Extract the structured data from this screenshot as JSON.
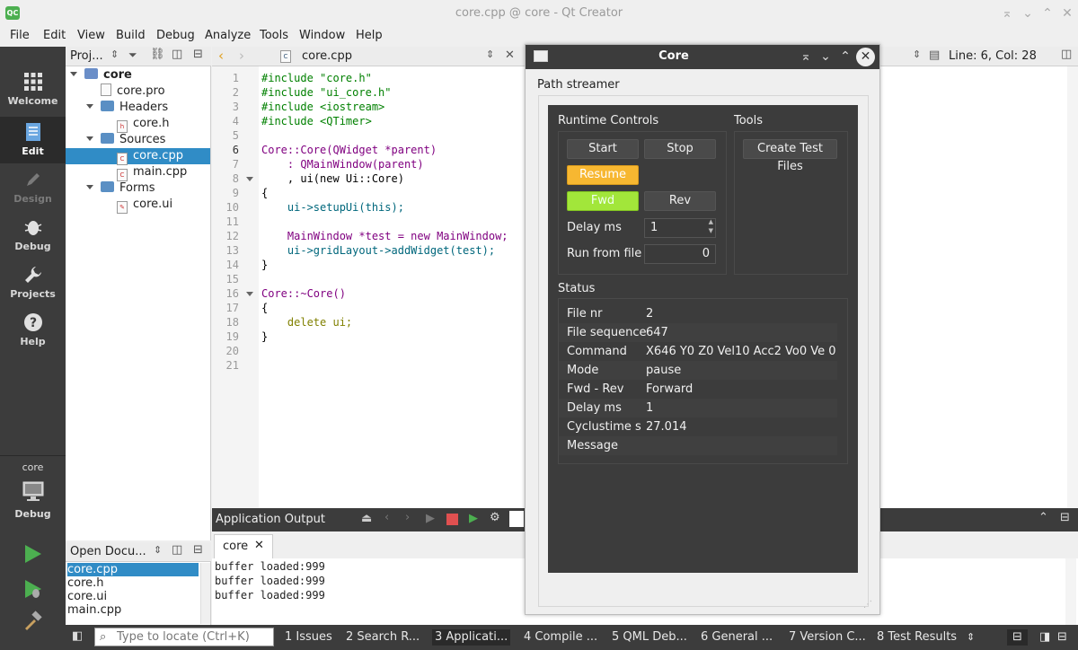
{
  "window": {
    "title": "core.cpp @ core - Qt Creator",
    "logo": "QC"
  },
  "menubar": [
    "File",
    "Edit",
    "View",
    "Build",
    "Debug",
    "Analyze",
    "Tools",
    "Window",
    "Help"
  ],
  "modes": [
    {
      "label": "Welcome"
    },
    {
      "label": "Edit"
    },
    {
      "label": "Design"
    },
    {
      "label": "Debug"
    },
    {
      "label": "Projects"
    },
    {
      "label": "Help"
    }
  ],
  "target": {
    "project": "core",
    "label": "Debug"
  },
  "project_panel": {
    "title": "Proj...",
    "tree": [
      "core",
      "core.pro",
      "Headers",
      "core.h",
      "Sources",
      "core.cpp",
      "main.cpp",
      "Forms",
      "core.ui"
    ]
  },
  "open_docs": {
    "title": "Open Docu...",
    "items": [
      "core.cpp",
      "core.h",
      "core.ui",
      "main.cpp"
    ]
  },
  "editor": {
    "file": "core.cpp",
    "position": "Line: 6, Col: 28",
    "line_numbers": [
      "1",
      "2",
      "3",
      "4",
      "5",
      "6",
      "7",
      "8",
      "9",
      "10",
      "11",
      "12",
      "13",
      "14",
      "15",
      "16",
      "17",
      "18",
      "19",
      "20",
      "21"
    ],
    "lines": [
      "#include \"core.h\"",
      "#include \"ui_core.h\"",
      "#include <iostream>",
      "#include <QTimer>",
      "",
      "Core::Core(QWidget *parent)",
      "    : QMainWindow(parent)",
      "    , ui(new Ui::Core)",
      "{",
      "    ui->setupUi(this);",
      "",
      "    MainWindow *test = new MainWindow;",
      "    ui->gridLayout->addWidget(test);",
      "}",
      "",
      "Core::~Core()",
      "{",
      "    delete ui;",
      "}",
      "",
      ""
    ]
  },
  "output": {
    "title": "Application Output",
    "tab": "core",
    "lines": [
      "buffer loaded:999",
      "buffer loaded:999",
      "buffer loaded:999"
    ]
  },
  "statusbar": {
    "locate_placeholder": "Type to locate (Ctrl+K)",
    "panes": [
      "1  Issues",
      "2  Search R...",
      "3  Applicati...",
      "4  Compile ...",
      "5  QML Deb...",
      "6  General ...",
      "7  Version C...",
      "8  Test Results"
    ]
  },
  "dialog": {
    "title": "Core",
    "group": "Path streamer",
    "runtime": {
      "title": "Runtime Controls",
      "start": "Start",
      "stop": "Stop",
      "resume": "Resume",
      "fwd": "Fwd",
      "rev": "Rev",
      "delay_label": "Delay ms",
      "delay_value": "1",
      "runfile_label": "Run from file",
      "runfile_value": "0"
    },
    "tools": {
      "title": "Tools",
      "create": "Create Test Files"
    },
    "status": {
      "title": "Status",
      "rows": [
        {
          "k": "File nr",
          "v": "2"
        },
        {
          "k": "File sequence",
          "v": "647"
        },
        {
          "k": "Command",
          "v": "X646 Y0 Z0 Vel10 Acc2 Vo0 Ve 0"
        },
        {
          "k": "Mode",
          "v": "pause"
        },
        {
          "k": "Fwd - Rev",
          "v": "Forward"
        },
        {
          "k": "Delay ms",
          "v": "1"
        },
        {
          "k": "Cyclustime s",
          "v": "27.014"
        },
        {
          "k": "Message",
          "v": ""
        }
      ]
    }
  },
  "colors": {
    "selection": "#308cc6",
    "resume": "#f7b731",
    "fwd": "#a2e63a",
    "dark": "#3c3c3c"
  }
}
